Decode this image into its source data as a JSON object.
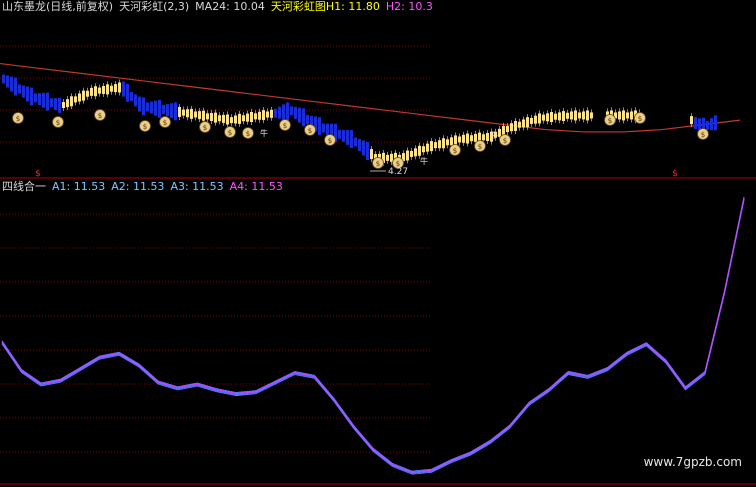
{
  "header": {
    "stock": "山东墨龙(日线,前复权)",
    "indicator": "天河彩虹(2,3)",
    "ma24": "MA24: 10.04",
    "rainbow_label": "天河彩虹图",
    "h1": "H1: 11.80",
    "h2": "H2: 10.3"
  },
  "sub_header": {
    "name": "四线合一",
    "a1": "A1: 11.53",
    "a2": "A2: 11.53",
    "a3": "A3: 11.53",
    "a4": "A4: 11.53"
  },
  "annotations": {
    "low_price": "4.27",
    "money_glyph": "$",
    "bull_glyph": "牛"
  },
  "watermark": "www.7gpzb.com",
  "colors": {
    "background": "#000000",
    "grid": "#8b0000",
    "text_white": "#d8d8d8",
    "text_yellow": "#ffff00",
    "text_magenta": "#ff55ff",
    "text_cyan": "#7fc7ff",
    "ma_line": "#c0392b",
    "candle_blue": "#1a2bd8",
    "candle_yellow": "#ffe38a",
    "a4_line": "#cc44ff",
    "a_lines": "#5577ff"
  },
  "chart_data": [
    {
      "type": "line",
      "panel": "main",
      "series": [
        {
          "name": "MA24",
          "values": [
            11.3,
            11.2,
            11.1,
            11.0,
            10.9,
            10.8,
            10.7,
            10.6,
            10.5,
            10.4,
            10.3,
            10.2,
            10.1,
            10.0,
            9.9,
            9.85,
            9.85,
            9.9,
            10.0,
            10.1
          ]
        }
      ]
    },
    {
      "type": "line",
      "panel": "sub",
      "series": [
        {
          "name": "A4",
          "values": [
            11.0,
            9.5,
            8.8,
            9.0,
            9.6,
            10.2,
            10.4,
            9.8,
            8.9,
            8.6,
            8.8,
            8.5,
            8.3,
            8.4,
            8.9,
            9.4,
            9.2,
            8.0,
            6.6,
            5.4,
            4.6,
            4.2,
            4.3,
            4.8,
            5.2,
            5.8,
            6.6,
            7.8,
            8.5,
            9.4,
            9.2,
            9.6,
            10.4,
            10.9,
            10.0,
            8.6,
            9.4,
            13.6,
            18.5
          ]
        }
      ]
    }
  ]
}
